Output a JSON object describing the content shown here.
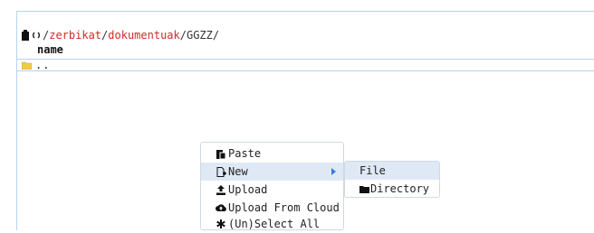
{
  "breadcrumb": {
    "root_segments": [
      "zerbikat",
      "dokumentuak"
    ],
    "current": "GGZZ",
    "separator": "/"
  },
  "table": {
    "column_name": "name",
    "rows": [
      {
        "name": "..",
        "icon": "folder-icon"
      }
    ]
  },
  "context_menu": {
    "items": [
      {
        "label": "Paste",
        "icon": "paste-icon"
      },
      {
        "label": "New",
        "icon": "new-file-icon",
        "has_submenu": true
      },
      {
        "label": "Upload",
        "icon": "upload-icon"
      },
      {
        "label": "Upload From Cloud",
        "icon": "cloud-upload-icon"
      },
      {
        "label": "(Un)Select All",
        "icon": "asterisk-icon"
      }
    ],
    "active_item": "New"
  },
  "submenu": {
    "items": [
      {
        "label": "File",
        "icon": ""
      },
      {
        "label": "Directory",
        "icon": "folder-icon"
      }
    ]
  },
  "colors": {
    "accent_red": "#d02a2a",
    "border_blue": "#b9d2ea",
    "highlight": "#dfe9f6",
    "arrow_blue": "#3b7bd6",
    "folder_yellow": "#f2c94c"
  }
}
